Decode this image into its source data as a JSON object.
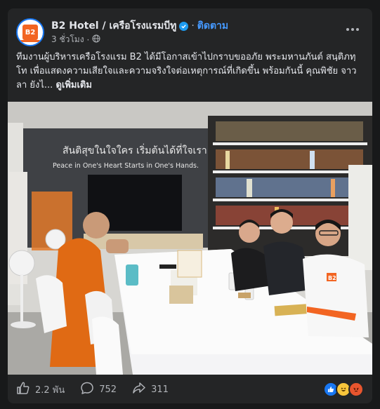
{
  "post": {
    "page_name": "B2 Hotel / เครือโรงแรมบีทู",
    "separator": "·",
    "follow_label": "ติดตาม",
    "time": "3 ชั่วโมง",
    "audience_icon": "globe-icon",
    "caption": "ทีมงานผู้บริหารเครือโรงแรม B2 ได้มีโอกาสเข้าไปกราบขออภัย พระมหานภันต์ สนฺติภทฺโท เพื่อแสดงความเสียใจและความจริงใจต่อเหตุการณ์ที่เกิดขึ้น พร้อมกันนี้ คุณพิชัย จาวลา ยังไ...",
    "see_more": "ดูเพิ่มเติม"
  },
  "avatar": {
    "logo_text": "B2"
  },
  "photo": {
    "wall_text_th": "สันติสุขในใจใคร เริ่มต้นได้ที่ใจเรา",
    "wall_text_en": "Peace in One's Heart Starts in One's Hands.",
    "shirt_logo": "B2"
  },
  "actions": {
    "like_icon": "thumbs-up-icon",
    "like_count": "2.2 พัน",
    "comment_icon": "comment-icon",
    "comment_count": "752",
    "share_icon": "share-icon",
    "share_count": "311"
  },
  "reactions": [
    "like",
    "haha",
    "angry"
  ],
  "colors": {
    "card_bg": "#242526",
    "page_bg": "#18191a",
    "accent_blue": "#4599ff",
    "brand_orange": "#f26522",
    "monk_robe": "#e06a14"
  }
}
